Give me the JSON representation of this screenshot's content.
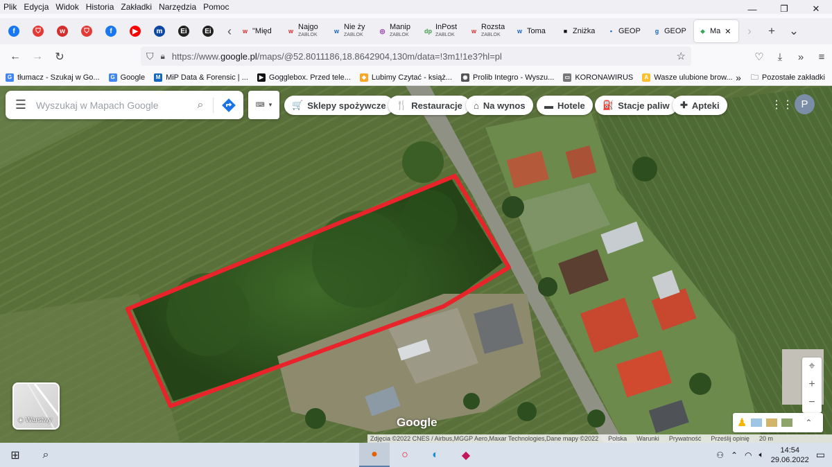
{
  "menu": [
    "Plik",
    "Edycja",
    "Widok",
    "Historia",
    "Zakładki",
    "Narzędzia",
    "Pomoc"
  ],
  "window_controls": {
    "minimize": "—",
    "restore": "❐",
    "close": "✕"
  },
  "pinned_tabs": [
    {
      "icon": "facebook-icon",
      "glyph": "f",
      "color": "#1877f2"
    },
    {
      "icon": "shield-icon",
      "glyph": "⛉",
      "color": "#e53935"
    },
    {
      "icon": "wp-icon",
      "glyph": "w",
      "color": "#d32f2f"
    },
    {
      "icon": "shield-icon",
      "glyph": "⛉",
      "color": "#e53935"
    },
    {
      "icon": "facebook-icon",
      "glyph": "f",
      "color": "#1877f2"
    },
    {
      "icon": "youtube-icon",
      "glyph": "▶",
      "color": "#ff0000"
    },
    {
      "icon": "m-icon",
      "glyph": "m",
      "color": "#0d47a1"
    },
    {
      "icon": "ei-icon",
      "glyph": "Ei",
      "color": "#222"
    },
    {
      "icon": "ei-icon",
      "glyph": "Ei",
      "color": "#222"
    }
  ],
  "tabs": [
    {
      "title": "\"Międ",
      "sub": "",
      "glyph": "w",
      "color": "#d32f2f"
    },
    {
      "title": "Najgo",
      "sub": "ZABLOK",
      "glyph": "w",
      "color": "#d32f2f"
    },
    {
      "title": "Nie ży",
      "sub": "ZABLOK",
      "glyph": "w",
      "color": "#1565c0"
    },
    {
      "title": "Manip",
      "sub": "ZABLOK",
      "glyph": "◎",
      "color": "#8e24aa"
    },
    {
      "title": "InPost",
      "sub": "ZABLOK",
      "glyph": "dp",
      "color": "#43a047"
    },
    {
      "title": "Rozsta",
      "sub": "ZABLOK",
      "glyph": "w",
      "color": "#d32f2f"
    },
    {
      "title": "Toma",
      "sub": "",
      "glyph": "w",
      "color": "#1565c0"
    },
    {
      "title": "Zniżka",
      "sub": "",
      "glyph": "■",
      "color": "#111"
    },
    {
      "title": "GEOP",
      "sub": "",
      "glyph": "•",
      "color": "#1565c0"
    },
    {
      "title": "GEOP",
      "sub": "",
      "glyph": "g",
      "color": "#1565c0"
    },
    {
      "title": "Ma",
      "sub": "",
      "glyph": "⬥",
      "color": "#34a853",
      "active": true,
      "close": "✕"
    }
  ],
  "tab_controls": {
    "scroll_left": "‹",
    "scroll_right": "›",
    "new_tab": "+",
    "list": "⌄"
  },
  "url": {
    "prefix": "https://www.",
    "domain": "google.pl",
    "path": "/maps/@52.8011186,18.8642904,130m/data=!3m1!1e3?hl=pl"
  },
  "bookmarks": [
    {
      "label": "tłumacz - Szukaj w Go...",
      "glyph": "G",
      "color": "#4285f4"
    },
    {
      "label": "Google",
      "glyph": "G",
      "color": "#4285f4"
    },
    {
      "label": "MiP Data & Forensic | ...",
      "glyph": "M",
      "color": "#1565c0"
    },
    {
      "label": "Gogglebox. Przed tele...",
      "glyph": "▶",
      "color": "#111"
    },
    {
      "label": "Lubimy Czytać - książ...",
      "glyph": "◆",
      "color": "#f9a825"
    },
    {
      "label": "Prolib Integro - Wyszu...",
      "glyph": "◉",
      "color": "#555"
    },
    {
      "label": "KORONAWIRUS",
      "glyph": "▭",
      "color": "#777"
    },
    {
      "label": "Wasze ulubione brow...",
      "glyph": "A",
      "color": "#fbc02d"
    }
  ],
  "bookmarks_more": "»",
  "bookmarks_other": "Pozostałe zakładki",
  "search": {
    "placeholder": "Wyszukaj w Mapach Google"
  },
  "chips": [
    {
      "label": "Sklepy spożywcze",
      "icon": "cart-icon",
      "glyph": "🛒"
    },
    {
      "label": "Restauracje",
      "icon": "fork-knife-icon",
      "glyph": "🍴"
    },
    {
      "label": "Na wynos",
      "icon": "takeout-icon",
      "glyph": "⌂"
    },
    {
      "label": "Hotele",
      "icon": "bed-icon",
      "glyph": "▬"
    },
    {
      "label": "Stacje paliw",
      "icon": "gas-pump-icon",
      "glyph": "⛽"
    },
    {
      "label": "Apteki",
      "icon": "pharmacy-icon",
      "glyph": "✚"
    }
  ],
  "avatar_initial": "P",
  "layers_label": "Warstwy",
  "google_logo": "Google",
  "zoom": {
    "in": "+",
    "out": "−"
  },
  "attribution": [
    "Zdjęcia ©2022 CNES / Airbus,MGGP Aero,Maxar Technologies,Dane mapy ©2022",
    "Polska",
    "Warunki",
    "Prywatność",
    "Prześlij opinię",
    "20 m"
  ],
  "taskbar": {
    "time": "14:54",
    "date": "29.06.2022"
  },
  "colors": {
    "outline": "#e8232a",
    "accent": "#1a73e8"
  }
}
